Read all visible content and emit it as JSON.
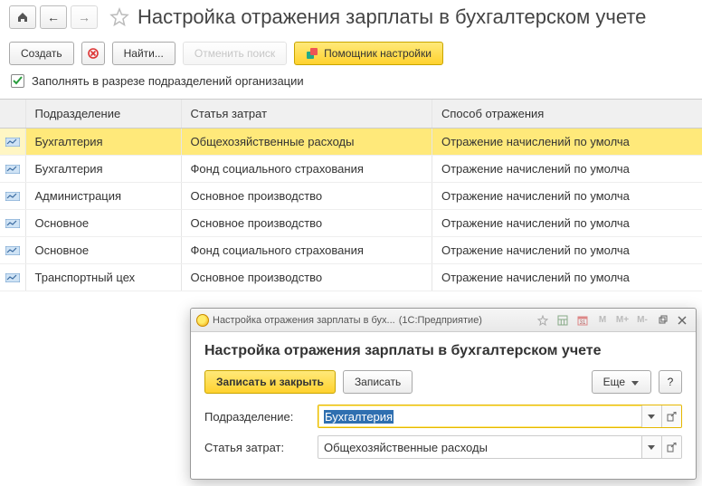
{
  "pageTitle": "Настройка отражения зарплаты в бухгалтерском учете",
  "toolbar": {
    "create": "Создать",
    "find": "Найти...",
    "cancelSearch": "Отменить поиск",
    "wizard": "Помощник настройки"
  },
  "checkbox": {
    "label": "Заполнять в разрезе подразделений организации"
  },
  "table": {
    "headers": {
      "dept": "Подразделение",
      "cost": "Статья затрат",
      "method": "Способ отражения"
    },
    "rows": [
      {
        "dept": "Бухгалтерия",
        "cost": "Общехозяйственные расходы",
        "method": "Отражение начислений по умолча"
      },
      {
        "dept": "Бухгалтерия",
        "cost": "Фонд социального страхования",
        "method": "Отражение начислений по умолча"
      },
      {
        "dept": "Администрация",
        "cost": "Основное производство",
        "method": "Отражение начислений по умолча"
      },
      {
        "dept": "Основное",
        "cost": "Основное производство",
        "method": "Отражение начислений по умолча"
      },
      {
        "dept": "Основное",
        "cost": "Фонд социального страхования",
        "method": "Отражение начислений по умолча"
      },
      {
        "dept": "Транспортный цех",
        "cost": "Основное производство",
        "method": "Отражение начислений по умолча"
      }
    ]
  },
  "dialog": {
    "winTitle": "Настройка отражения зарплаты в бух...",
    "winApp": "(1С:Предприятие)",
    "heading": "Настройка отражения зарплаты в бухгалтерском учете",
    "saveClose": "Записать и закрыть",
    "save": "Записать",
    "more": "Еще",
    "help": "?",
    "fields": {
      "deptLabel": "Подразделение:",
      "deptValue": "Бухгалтерия",
      "costLabel": "Статья затрат:",
      "costValue": "Общехозяйственные расходы"
    },
    "titlebtns": {
      "m": "M",
      "mplus": "M+",
      "mminus": "M-"
    }
  }
}
